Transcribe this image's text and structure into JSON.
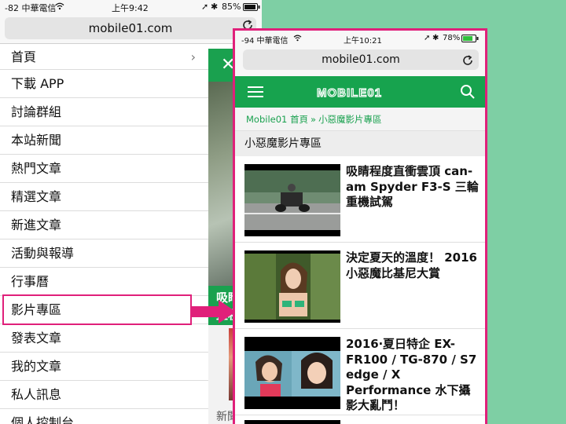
{
  "left_phone": {
    "status": {
      "signal": "-82 中華電信",
      "time": "上午9:42",
      "battery": "85%"
    },
    "url": "mobile01.com",
    "menu": [
      {
        "label": "首頁",
        "has_chevron": true
      },
      {
        "label": "下載 APP"
      },
      {
        "label": "討論群組"
      },
      {
        "label": "本站新聞"
      },
      {
        "label": "熱門文章"
      },
      {
        "label": "精選文章"
      },
      {
        "label": "新進文章"
      },
      {
        "label": "活動與報導"
      },
      {
        "label": "行事曆"
      },
      {
        "label": "影片專區",
        "highlighted": true
      },
      {
        "label": "發表文章"
      },
      {
        "label": "我的文章"
      },
      {
        "label": "私人訊息"
      },
      {
        "label": "個人控制台"
      }
    ],
    "strip": {
      "close": "✕",
      "green_text": "吸睛\n直種",
      "bottom_label": "新聞"
    }
  },
  "right_phone": {
    "status": {
      "signal": "-94 中華電信",
      "time": "上午10:21",
      "battery": "78%"
    },
    "url": "mobile01.com",
    "brand": "MOBILE01",
    "breadcrumb": {
      "home": "Mobile01 首頁",
      "sep": "»",
      "current": "小惡魔影片專區"
    },
    "section_title": "小惡魔影片專區",
    "articles": [
      {
        "title": "吸睛程度直衝雲頂 can-am Spyder F3-S 三輪重機試駕"
      },
      {
        "title": "決定夏天的溫度！ 2016 小惡魔比基尼大賞"
      },
      {
        "title": "2016‧夏日特企 EX-FR100 / TG-870 / S7 edge / X Performance 水下攝影大亂鬥！"
      }
    ]
  },
  "colors": {
    "brand_green": "#17a34e",
    "highlight_pink": "#e0207a",
    "background": "#7ecfa4"
  }
}
